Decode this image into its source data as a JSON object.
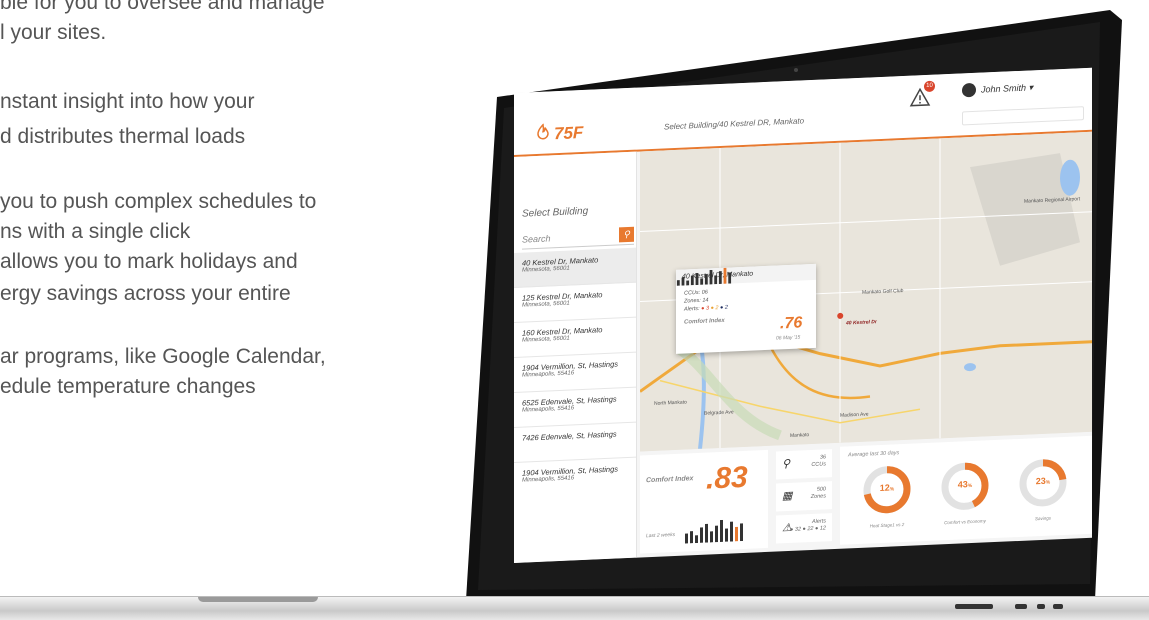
{
  "marketing": {
    "lines": [
      "ble for you to oversee and manage",
      "l your sites.",
      "nstant insight into how your",
      "d distributes thermal loads",
      "you to push complex schedules to",
      "ns with a single click",
      "allows you to mark holidays and",
      "ergy savings across your entire",
      "ar programs, like Google Calendar,",
      "edule temperature changes"
    ]
  },
  "app": {
    "logo_text": "75F",
    "breadcrumb": "Select Building/40 Kestrel DR, Mankato",
    "alert_count": "10",
    "user_name": "John Smith ▾"
  },
  "sidebar": {
    "title": "Select Building",
    "search_placeholder": "Search",
    "buildings": [
      {
        "name": "40 Kestrel Dr, Mankato",
        "sub": "Minnesota, 56001",
        "active": true
      },
      {
        "name": "125 Kestrel Dr, Mankato",
        "sub": "Minnesota, 56001"
      },
      {
        "name": "160 Kestrel Dr, Mankato",
        "sub": "Minnesota, 56001"
      },
      {
        "name": "1904 Vermillion, St, Hastings",
        "sub": "Minneapolis, 55416"
      },
      {
        "name": "6525 Edenvale, St, Hastings",
        "sub": "Minneapolis, 55416"
      },
      {
        "name": "7426 Edenvale, St, Hastings",
        "sub": ""
      },
      {
        "name": "1904 Vermillion, St, Hastings",
        "sub": "Minneapolis, 55416"
      }
    ]
  },
  "map": {
    "labels": [
      "Mankato Golf Club",
      "Mankato Regional Airport",
      "North Mankato",
      "Mankato",
      "Belgrade Ave",
      "Madison Ave"
    ],
    "popup": {
      "title": "40 Kestrel Dr, Mankato",
      "ccus": "CCUs: 06",
      "zones": "Zones: 14",
      "alerts_label": "Alerts:",
      "alerts": [
        "● 3",
        "● 2",
        "● 2"
      ],
      "comfort_label": "Comfort Index",
      "comfort_value": ".76",
      "date": "06 May '15",
      "bars": [
        0.35,
        0.5,
        0.3,
        0.6,
        0.75,
        0.4,
        0.65,
        0.9,
        0.55,
        0.8,
        1.0,
        0.7
      ]
    },
    "pin_label": "40 Kestrel Dr"
  },
  "dashboard": {
    "comfort_label": "Comfort Index",
    "comfort_value": ".83",
    "period": "Last 2 weeks",
    "bars": [
      0.45,
      0.55,
      0.35,
      0.7,
      0.85,
      0.5,
      0.75,
      1.0,
      0.6,
      0.9,
      0.65,
      0.8
    ],
    "ccus": "36\nCCUs",
    "zones": "500\nZones",
    "alerts": "Alerts\n● 32 ● 22 ● 12",
    "avg_label": "Average last 30 days",
    "rings": [
      {
        "value": "12",
        "unit": "%",
        "label": "Heat Stage1 vs 2",
        "fraction": 0.72,
        "color": "#e8792f"
      },
      {
        "value": "43",
        "unit": "%",
        "label": "Comfort vs Economy",
        "fraction": 0.43,
        "color": "#e8792f"
      },
      {
        "value": "23",
        "unit": "%",
        "label": "Savings",
        "fraction": 0.23,
        "color": "#e8792f"
      }
    ]
  }
}
